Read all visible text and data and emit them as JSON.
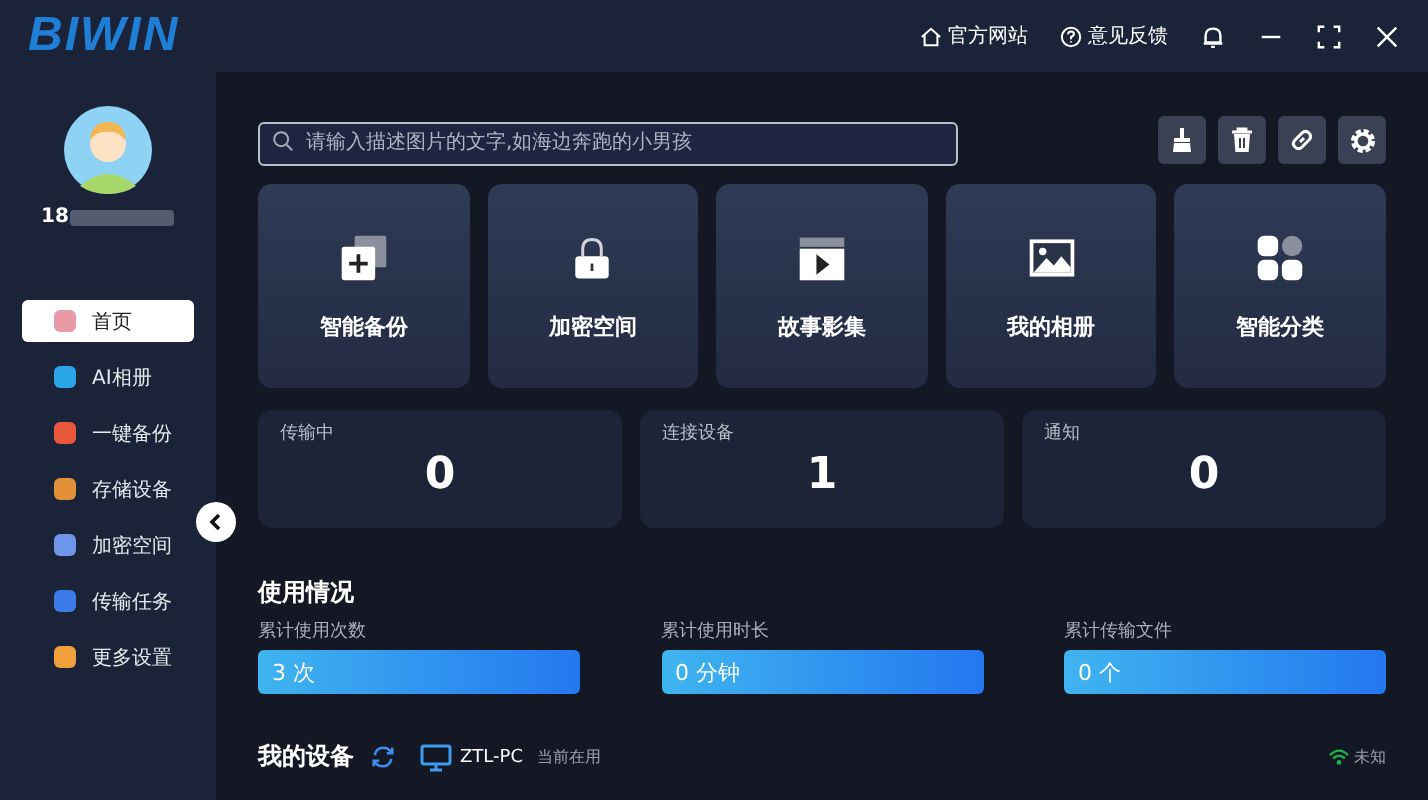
{
  "logo": "BIWIN",
  "header_links": [
    {
      "label": "官方网站",
      "kind": "home"
    },
    {
      "label": "意见反馈",
      "kind": "help"
    }
  ],
  "user": {
    "phone": "18"
  },
  "nav": [
    {
      "label": "首页",
      "selected": true,
      "color": "#e89aa8"
    },
    {
      "label": "AI相册",
      "selected": false,
      "color": "#2aa6e8"
    },
    {
      "label": "一键备份",
      "selected": false,
      "color": "#e8573a"
    },
    {
      "label": "存储设备",
      "selected": false,
      "color": "#e0913a"
    },
    {
      "label": "加密空间",
      "selected": false,
      "color": "#6f95e8"
    },
    {
      "label": "传输任务",
      "selected": false,
      "color": "#3a7be8"
    },
    {
      "label": "更多设置",
      "selected": false,
      "color": "#f0a03a"
    }
  ],
  "search": {
    "placeholder": "请输入描述图片的文字,如海边奔跑的小男孩"
  },
  "tools": [
    {
      "kind": "brush"
    },
    {
      "kind": "trash"
    },
    {
      "kind": "link"
    },
    {
      "kind": "gear"
    }
  ],
  "features": [
    {
      "label": "智能备份",
      "kind": "backup"
    },
    {
      "label": "加密空间",
      "kind": "lock"
    },
    {
      "label": "故事影集",
      "kind": "video"
    },
    {
      "label": "我的相册",
      "kind": "image"
    },
    {
      "label": "智能分类",
      "kind": "category"
    }
  ],
  "stats": [
    {
      "label": "传输中",
      "value": "0"
    },
    {
      "label": "连接设备",
      "value": "1"
    },
    {
      "label": "通知",
      "value": "0"
    }
  ],
  "usage": {
    "title": "使用情况",
    "items": [
      {
        "label": "累计使用次数",
        "value": "3 次"
      },
      {
        "label": "累计使用时长",
        "value": "0 分钟"
      },
      {
        "label": "累计传输文件",
        "value": "0 个"
      }
    ]
  },
  "devices": {
    "title": "我的设备",
    "name": "ZTL-PC",
    "status": "当前在用",
    "network": "未知"
  }
}
